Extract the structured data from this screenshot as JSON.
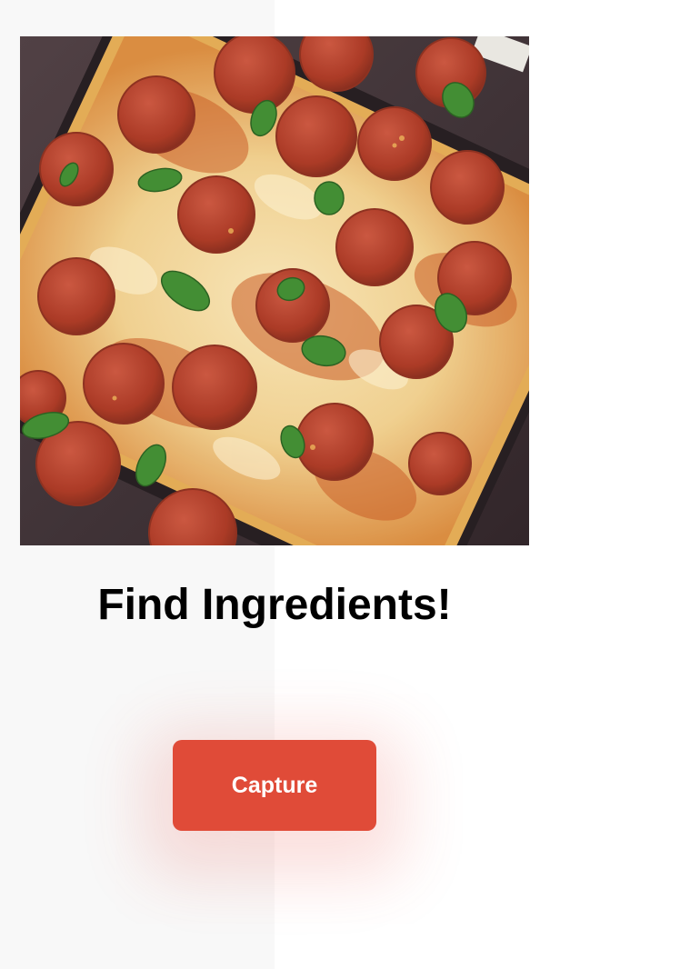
{
  "photo": {
    "subject": "pepperoni pizza with basil on dark tray",
    "colors": {
      "crust": "#e8b85a",
      "cheese": "#f4dca8",
      "sauce": "#c9571f",
      "pepperoni": "#b33a22",
      "basil": "#3c8a2c",
      "tray": "#2b1f22"
    }
  },
  "main": {
    "title": "Find Ingredients!"
  },
  "actions": {
    "capture_label": "Capture",
    "capture_color": "#e04b38"
  }
}
